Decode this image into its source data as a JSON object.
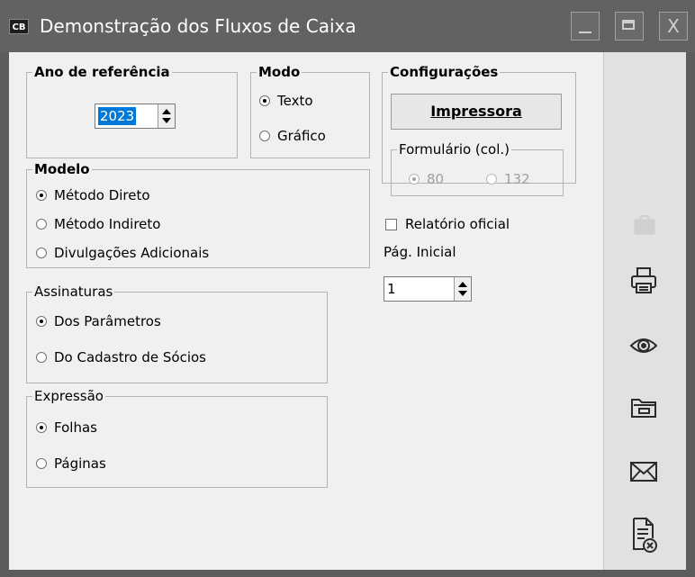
{
  "window": {
    "app_icon": "CB",
    "title": "Demonstração dos Fluxos de Caixa",
    "minimize_icon": "minimize-icon",
    "maximize_icon": "maximize-icon",
    "close_icon": "close-icon",
    "close_glyph": "X"
  },
  "ano": {
    "legend": "Ano de referência",
    "value": "2023"
  },
  "modo": {
    "legend": "Modo",
    "options": [
      {
        "label": "Texto",
        "selected": true
      },
      {
        "label": "Gráfico",
        "selected": false
      }
    ]
  },
  "configuracoes": {
    "legend": "Configurações",
    "impressora_label": "Impressora",
    "formulario": {
      "legend": "Formulário (col.)",
      "options": [
        {
          "label": "80",
          "selected": true
        },
        {
          "label": "132",
          "selected": false
        }
      ]
    }
  },
  "modelo": {
    "legend": "Modelo",
    "options": [
      {
        "label": "Método Direto",
        "selected": true
      },
      {
        "label": "Método Indireto",
        "selected": false
      },
      {
        "label": "Divulgações Adicionais",
        "selected": false
      }
    ]
  },
  "relatorio": {
    "label": "Relatório oficial",
    "checked": false
  },
  "pagina": {
    "label": "Pág. Inicial",
    "value": "1"
  },
  "assinaturas": {
    "legend": "Assinaturas",
    "options": [
      {
        "label": "Dos Parâmetros",
        "selected": true
      },
      {
        "label": "Do Cadastro de Sócios",
        "selected": false
      }
    ]
  },
  "expressao": {
    "legend": "Expressão",
    "options": [
      {
        "label": "Folhas",
        "selected": true
      },
      {
        "label": "Páginas",
        "selected": false
      }
    ]
  },
  "sidebar": {
    "icons": [
      "briefcase-icon",
      "printer-icon",
      "eye-icon",
      "folder-icon",
      "envelope-icon",
      "close-document-icon"
    ]
  }
}
